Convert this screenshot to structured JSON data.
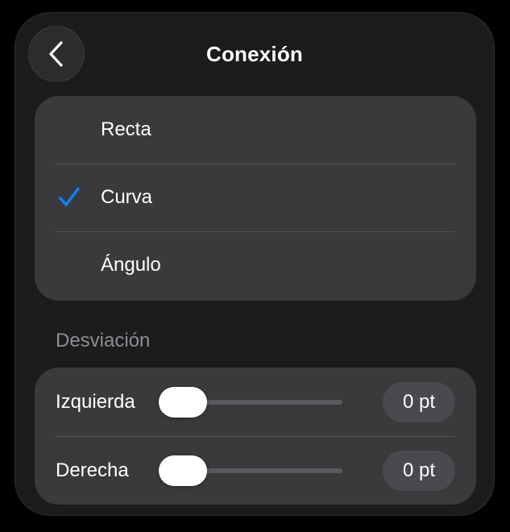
{
  "header": {
    "title": "Conexión",
    "back_icon": "chevron-left-icon"
  },
  "connection": {
    "options": [
      {
        "label": "Recta",
        "selected": false
      },
      {
        "label": "Curva",
        "selected": true
      },
      {
        "label": "Ángulo",
        "selected": false
      }
    ],
    "check_icon": "checkmark-icon"
  },
  "offset": {
    "section_label": "Desviación",
    "left": {
      "label": "Izquierda",
      "value": "0 pt",
      "slider_fraction": 0
    },
    "right": {
      "label": "Derecha",
      "value": "0 pt",
      "slider_fraction": 0
    }
  },
  "colors": {
    "accent": "#0a84ff",
    "panel": "#1c1c1e",
    "group": "#3a3a3c",
    "secondary_text": "#8e8e93"
  }
}
